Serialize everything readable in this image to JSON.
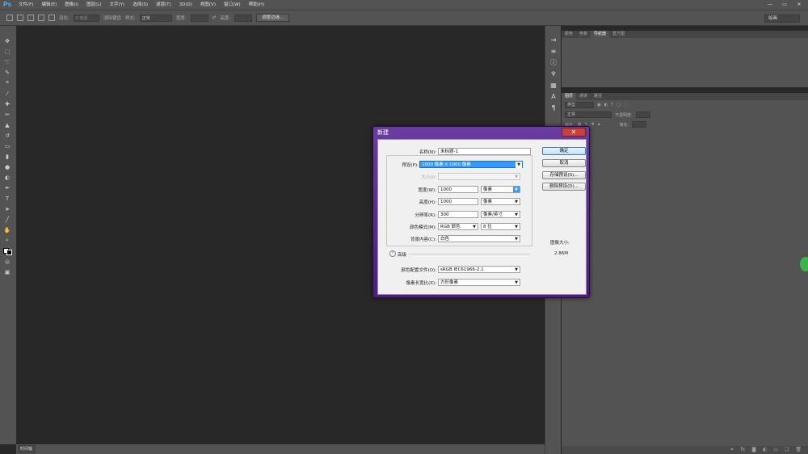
{
  "app": {
    "logo": "Ps"
  },
  "menu": [
    "文件(F)",
    "编辑(E)",
    "图像(I)",
    "图层(L)",
    "文字(Y)",
    "选择(S)",
    "滤镜(T)",
    "3D(D)",
    "视图(V)",
    "窗口(W)",
    "帮助(H)"
  ],
  "window_controls": {
    "minimize": "—",
    "restore": "▭",
    "close": "✕"
  },
  "options": {
    "feather_label": "羽化:",
    "feather_value": "0 像素",
    "antialias_label": "消除锯齿",
    "style_label": "样式:",
    "style_value": "正常",
    "width_label": "宽度:",
    "height_label": "高度:",
    "refine_button": "调整边缘...",
    "workspace": "绘画"
  },
  "panels": {
    "top_tabs": [
      "颜色",
      "色板",
      "导航器",
      "直方图"
    ],
    "top_active": 2,
    "layer_tabs": [
      "图层",
      "通道",
      "路径"
    ],
    "layer_active": 0,
    "kind_filter": "类型",
    "blend_mode": "正常",
    "opacity_label": "不透明度:",
    "lock_label": "锁定:",
    "fill_label": "填充:"
  },
  "statusbar": {
    "timeline_tab": "时间轴"
  },
  "dialog": {
    "title": "新建",
    "close": "✕",
    "name_label": "名称(N):",
    "name_value": "未标题-1",
    "preset_label": "预设(P):",
    "preset_value": "1000 像素 X 1000 像素",
    "size_label": "大小(I):",
    "width_label": "宽度(W):",
    "width_value": "1000",
    "width_unit": "像素",
    "height_label": "高度(H):",
    "height_value": "1000",
    "height_unit": "像素",
    "resolution_label": "分辨率(R):",
    "resolution_value": "300",
    "resolution_unit": "像素/英寸",
    "color_mode_label": "颜色模式(M):",
    "color_mode_value": "RGB 颜色",
    "bit_depth_value": "8 位",
    "background_label": "背景内容(C):",
    "background_value": "白色",
    "advanced_label": "高级",
    "profile_label": "颜色配置文件(O):",
    "profile_value": "sRGB IEC61966-2.1",
    "pixel_aspect_label": "像素长宽比(X):",
    "pixel_aspect_value": "方形像素",
    "ok_button": "确定",
    "cancel_button": "取消",
    "save_preset_button": "存储预设(S)...",
    "delete_preset_button": "删除预设(D)...",
    "image_size_label": "图像大小:",
    "image_size_value": "2.86M"
  },
  "colors": {
    "accent": "#3399ff",
    "dialog_frame": "#5a2d8c",
    "workspace": "#282828",
    "chrome": "#535353"
  }
}
